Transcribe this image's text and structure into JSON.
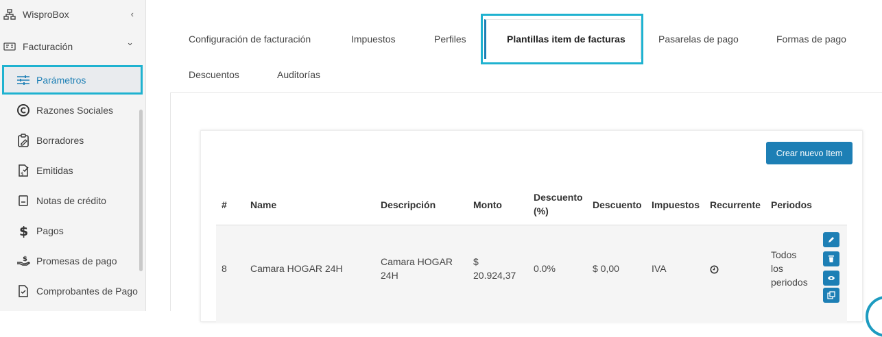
{
  "sidebar": {
    "top_items": [
      {
        "label": "WisproBox",
        "chevron": "‹"
      },
      {
        "label": "Facturación",
        "chevron": "⌄"
      }
    ],
    "sub_items": [
      {
        "label": "Parámetros"
      },
      {
        "label": "Razones Sociales"
      },
      {
        "label": "Borradores"
      },
      {
        "label": "Emitidas"
      },
      {
        "label": "Notas de crédito"
      },
      {
        "label": "Pagos"
      },
      {
        "label": "Promesas de pago"
      },
      {
        "label": "Comprobantes de Pago"
      }
    ]
  },
  "tabs": [
    {
      "label": "Configuración de facturación"
    },
    {
      "label": "Impuestos"
    },
    {
      "label": "Perfiles"
    },
    {
      "label": "Plantillas item de facturas"
    },
    {
      "label": "Pasarelas de pago"
    },
    {
      "label": "Formas de pago"
    },
    {
      "label": "Descuentos"
    },
    {
      "label": "Auditorías"
    }
  ],
  "table": {
    "create_button": "Crear nuevo Item",
    "headers": {
      "num": "#",
      "name": "Name",
      "descripcion": "Descripción",
      "monto": "Monto",
      "descuento_pct_1": "Descuento",
      "descuento_pct_2": "(%)",
      "descuento": "Descuento",
      "impuestos": "Impuestos",
      "recurrente": "Recurrente",
      "periodos": "Periodos"
    },
    "rows": [
      {
        "num": "8",
        "name": "Camara HOGAR 24H",
        "descripcion_1": "Camara HOGAR",
        "descripcion_2": "24H",
        "monto_1": "$",
        "monto_2": "20.924,37",
        "descuento_pct": "0.0%",
        "descuento": "$ 0,00",
        "impuestos": "IVA",
        "recurrente_icon": "clock-icon",
        "periodos_1": "Todos",
        "periodos_2": "los",
        "periodos_3": "periodos"
      }
    ]
  },
  "colors": {
    "accent": "#1d7fb5",
    "highlight": "#1fb2d0"
  }
}
